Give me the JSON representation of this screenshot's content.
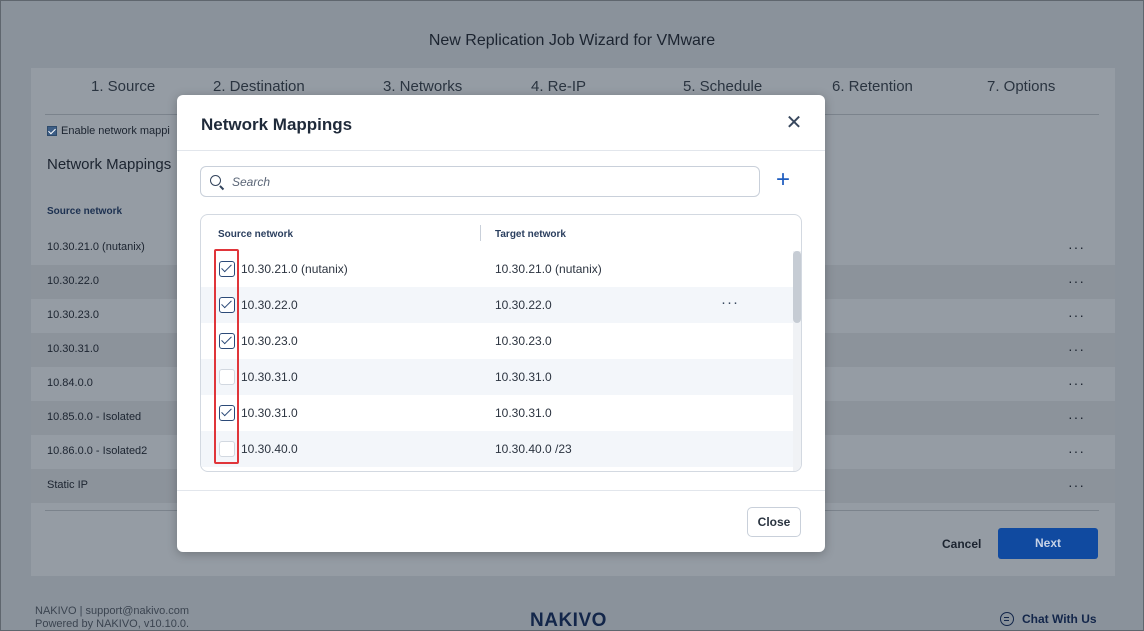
{
  "wizard": {
    "title": "New Replication Job Wizard for VMware",
    "steps": [
      "1. Source",
      "2. Destination",
      "3. Networks",
      "4. Re-IP",
      "5. Schedule",
      "6. Retention",
      "7. Options"
    ],
    "enable_checkbox_label": "Enable network mappi",
    "section_heading": "Network Mappings",
    "source_col_header": "Source network",
    "rows": [
      "10.30.21.0 (nutanix)",
      "10.30.22.0",
      "10.30.23.0",
      "10.30.31.0",
      "10.84.0.0",
      "10.85.0.0 - Isolated",
      "10.86.0.0 - Isolated2",
      "Static IP"
    ],
    "row_menu_glyph": "···",
    "cancel_label": "Cancel",
    "next_label": "Next"
  },
  "modal": {
    "title": "Network Mappings",
    "close_glyph": "✕",
    "search_placeholder": "Search",
    "add_glyph": "+",
    "columns": {
      "source": "Source network",
      "target": "Target network"
    },
    "rows": [
      {
        "source": "10.30.21.0 (nutanix)",
        "target": "10.30.21.0 (nutanix)",
        "checked": true
      },
      {
        "source": "10.30.22.0",
        "target": "10.30.22.0",
        "checked": true,
        "menu": "···"
      },
      {
        "source": "10.30.23.0",
        "target": "10.30.23.0",
        "checked": true
      },
      {
        "source": "10.30.31.0",
        "target": "10.30.31.0",
        "checked": false
      },
      {
        "source": "10.30.31.0",
        "target": "10.30.31.0",
        "checked": true
      },
      {
        "source": "10.30.40.0",
        "target": "10.30.40.0 /23",
        "checked": false
      }
    ],
    "close_button_label": "Close"
  },
  "footer": {
    "contact": "NAKIVO | support@nakivo.com",
    "powered": "Powered by NAKIVO, v10.10.0.",
    "logo": "NAKIVO",
    "chat_label": "Chat With Us"
  },
  "colors": {
    "accent": "#104aa0",
    "highlight": "#e0353a",
    "checkbox": "#2c4a78"
  }
}
